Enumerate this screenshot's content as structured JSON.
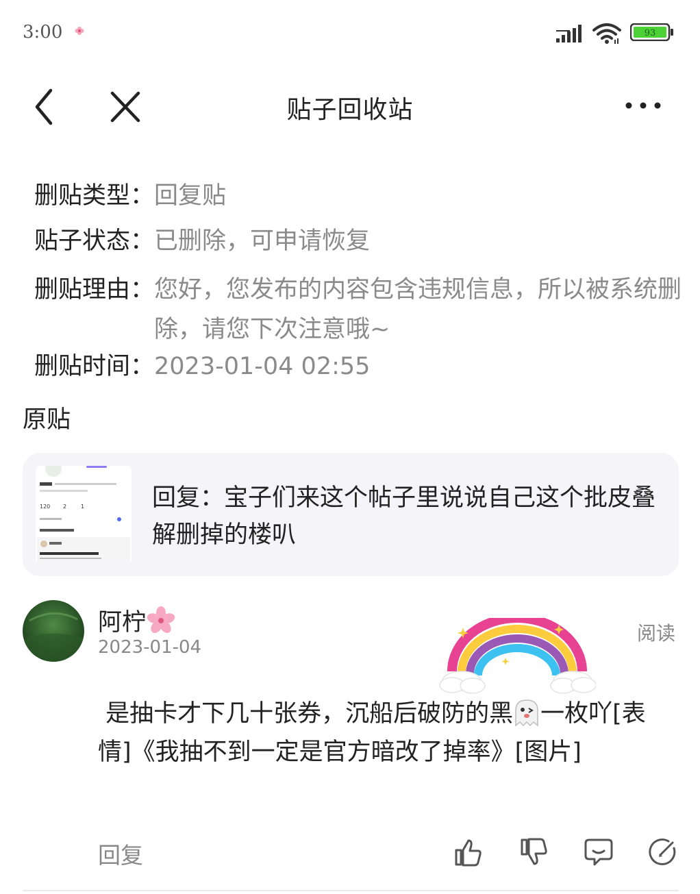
{
  "status_bar": {
    "time": "3:00",
    "battery_level": "93",
    "battery_color": "#4cd137"
  },
  "nav": {
    "title": "贴子回收站"
  },
  "info": {
    "type_label": "删贴类型：",
    "type_value": "回复贴",
    "status_label": "贴子状态：",
    "status_value": "已删除，可申请恢复",
    "reason_label": "删贴理由：",
    "reason_value": "您好，您发布的内容包含违规信息，所以被系统删除，请您下次注意哦~",
    "time_label": "删贴时间：",
    "time_value": "2023-01-04 02:55"
  },
  "original": {
    "section_label": "原贴",
    "text": "回复：宝子们来这个帖子里说说自己这个批皮叠解删掉的楼叭",
    "thumbnail_stats": [
      "120",
      "2",
      "1"
    ]
  },
  "comment": {
    "username": "阿柠",
    "date": "2023-01-04",
    "read_label": "阅读",
    "text_before_emoji": " 是抽卡才下几十张券，沉船后破防的黑",
    "text_after_emoji": "一枚吖[表情]《我抽不到一定是官方暗改了掉率》[图片]",
    "reply_label": "回复"
  },
  "icons": [
    "signal-icon",
    "wifi-icon",
    "battery-icon",
    "back-icon",
    "close-icon",
    "more-icon",
    "flower-emoji-icon",
    "ghost-emoji-icon",
    "rainbow-sticker",
    "thumbs-up-icon",
    "thumbs-down-icon",
    "comment-icon",
    "edit-icon"
  ]
}
